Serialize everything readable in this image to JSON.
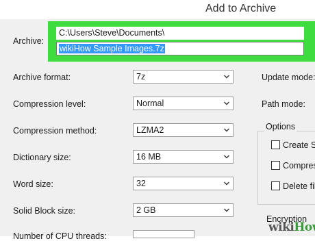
{
  "dialog": {
    "title": "Add to Archive"
  },
  "archive": {
    "label": "Archive:",
    "path": "C:\\Users\\Steve\\Documents\\",
    "filename": "wikiHow Sample Images.7z",
    "highlight_color": "#3fdc3f"
  },
  "settings": [
    {
      "label": "Archive format:",
      "value": "7z"
    },
    {
      "label": "Compression level:",
      "value": "Normal"
    },
    {
      "label": "Compression method:",
      "value": "LZMA2"
    },
    {
      "label": "Dictionary size:",
      "value": "16 MB"
    },
    {
      "label": "Word size:",
      "value": "32"
    },
    {
      "label": "Solid Block size:",
      "value": "2 GB"
    },
    {
      "label": "Number of CPU threads:",
      "value": ""
    }
  ],
  "right": {
    "update_mode_label": "Update mode:",
    "path_mode_label": "Path mode:",
    "options_title": "Options",
    "options": [
      "Create S",
      "Compres",
      "Delete fil"
    ],
    "encryption_label": "Encryption"
  },
  "watermark": {
    "wiki": "wiki",
    "how": "How"
  },
  "icons": {
    "dropdown": "chevron-down-icon"
  }
}
